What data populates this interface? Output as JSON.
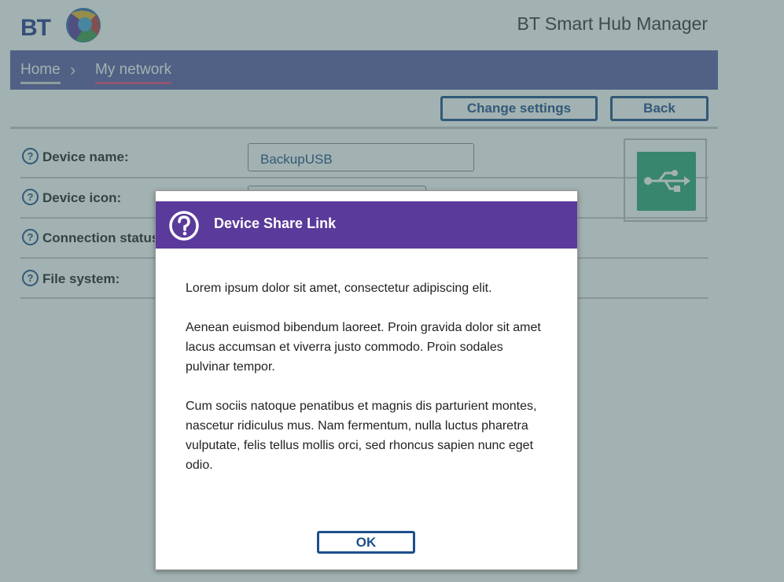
{
  "header": {
    "logo_text": "BT",
    "app_title": "BT Smart Hub Manager"
  },
  "breadcrumb": {
    "home": "Home",
    "current": "My network"
  },
  "actions": {
    "change_settings": "Change settings",
    "back": "Back"
  },
  "device": {
    "name_label": "Device name:",
    "name_value": "BackupUSB",
    "icon_label": "Device icon:",
    "connection_label": "Connection status:",
    "file_system_label": "File system:",
    "icon_name": "usb-icon",
    "icon_color": "#2aa977"
  },
  "modal": {
    "title": "Device Share Link",
    "paragraphs": [
      "Lorem ipsum dolor sit amet, consectetur adipiscing elit.",
      "Aenean euismod bibendum laoreet. Proin gravida dolor sit amet lacus accumsan et viverra justo commodo. Proin sodales pulvinar tempor.",
      "Cum sociis natoque penatibus et magnis dis parturient montes, nascetur ridiculus mus. Nam fermentum, nulla luctus pharetra vulputate, felis tellus mollis orci, sed rhoncus sapien nunc eget odio."
    ],
    "ok_label": "OK"
  },
  "colors": {
    "nav_bar": "#5b5ea6",
    "modal_header": "#5a3a9a",
    "accent_blue": "#1d4f8c",
    "breadcrumb_underline": "#e0457f"
  }
}
